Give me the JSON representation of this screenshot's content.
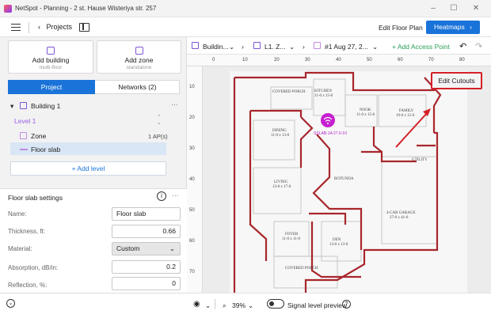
{
  "window": {
    "title": "NetSpot - Planning - 2 st. Hause Wisteriya str. 257"
  },
  "toolbar": {
    "projects_label": "Projects",
    "edit_floor_plan_label": "Edit Floor Plan",
    "heatmaps_label": "Heatmaps"
  },
  "left": {
    "add_building": {
      "label": "Add building",
      "sub": "multi-floor"
    },
    "add_zone": {
      "label": "Add zone",
      "sub": "standalone"
    },
    "tabs": {
      "project": "Project",
      "networks": "Networks (2)"
    },
    "tree": {
      "building": "Building 1",
      "level": "Level 1",
      "zone": "Zone",
      "zone_count": "1 AP(s)",
      "floor_slab": "Floor slab",
      "add_level": "+ Add level"
    },
    "settings": {
      "title": "Floor slab settings",
      "fields": [
        {
          "label": "Name:",
          "value": "Floor slab"
        },
        {
          "label": "Thickness, ft:",
          "value": "0.66"
        },
        {
          "label": "Material:",
          "value": "Custom"
        },
        {
          "label": "Absorption, dB/in:",
          "value": "0.2"
        },
        {
          "label": "Reflection, %:",
          "value": "0"
        }
      ]
    }
  },
  "breadcrumb": {
    "building": "Buildin...",
    "level": "L1. Z...",
    "snapshot": "#1 Aug 27, 2...",
    "add_access_point": "+ Add Access Point"
  },
  "ruler": {
    "x_ticks": [
      "0",
      "10",
      "20",
      "30",
      "40",
      "50",
      "60",
      "70",
      "80"
    ],
    "y_ticks": [
      "10",
      "20",
      "30",
      "40",
      "50",
      "60",
      "70"
    ]
  },
  "canvas": {
    "rooms": [
      {
        "name": "COVERED PORCH",
        "dims": ""
      },
      {
        "name": "KITCHEN",
        "dims": "11-0 x 15-0"
      },
      {
        "name": "NOOK",
        "dims": "11-0 x 15-0"
      },
      {
        "name": "FAMILY",
        "dims": "19-0 x 15-0"
      },
      {
        "name": "DINING",
        "dims": "11-0 x 13-0"
      },
      {
        "name": "UTILITY",
        "dims": ""
      },
      {
        "name": "LIVING",
        "dims": "13-0 x 17-0"
      },
      {
        "name": "ROTUNDA",
        "dims": ""
      },
      {
        "name": "4-CAR GARAGE",
        "dims": "27-0 x 41-0"
      },
      {
        "name": "FOYER",
        "dims": "11-0 x 11-0"
      },
      {
        "name": "DEN",
        "dims": "13-0 x 13-0"
      },
      {
        "name": "COVERED PORCH",
        "dims": ""
      }
    ],
    "ap_label": "SSLAB-1A 27.0-10",
    "edit_cutouts_label": "Edit Cutouts",
    "accent": "#d42027"
  },
  "statusbar": {
    "zoom": "39%",
    "signal_preview_label": "Signal level preview"
  }
}
